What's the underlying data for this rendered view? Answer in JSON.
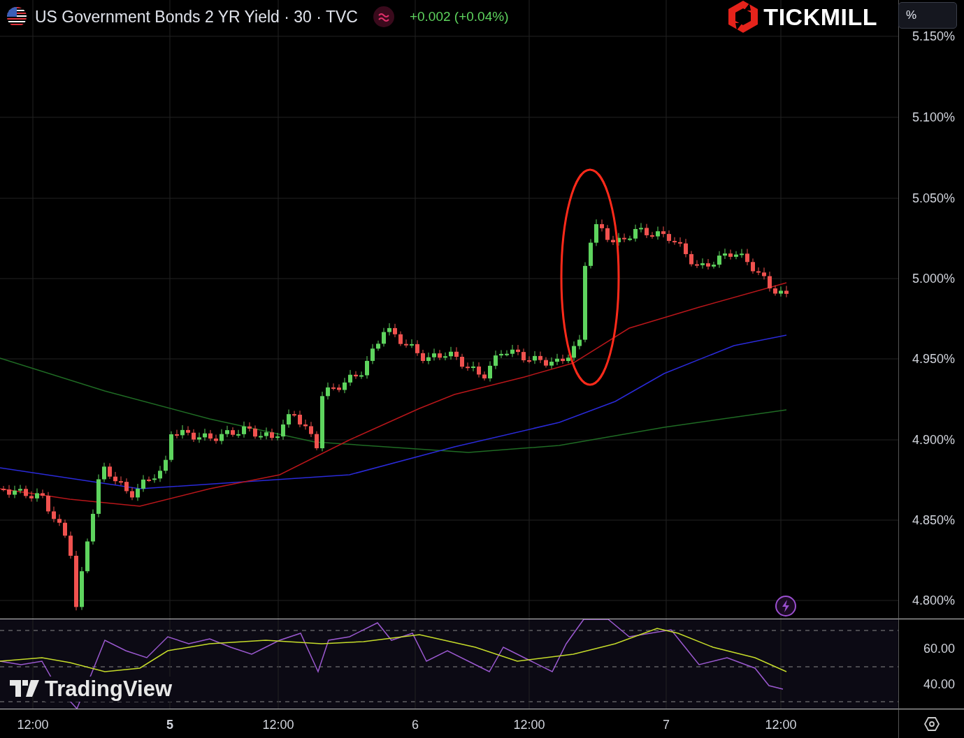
{
  "header": {
    "title": "US Government Bonds 2 YR Yield · 30 · TVC",
    "change": "+0.002 (+0.04%)"
  },
  "brand": {
    "name": "TICKMILL"
  },
  "unit_field": {
    "value": "%"
  },
  "price_axis": {
    "labels": [
      "5.150%",
      "5.100%",
      "5.050%",
      "5.000%",
      "4.950%",
      "4.900%",
      "4.850%",
      "4.800%"
    ]
  },
  "indicator_axis": {
    "labels": [
      "60.00",
      "40.00"
    ]
  },
  "watermark": {
    "text": "TradingView"
  },
  "time_axis": {
    "labels": [
      {
        "text": "12:00",
        "emphasis": false
      },
      {
        "text": "5",
        "emphasis": true
      },
      {
        "text": "12:00",
        "emphasis": false
      },
      {
        "text": "6",
        "emphasis": false
      },
      {
        "text": "12:00",
        "emphasis": false
      },
      {
        "text": "7",
        "emphasis": false
      },
      {
        "text": "12:00",
        "emphasis": false
      }
    ]
  }
}
